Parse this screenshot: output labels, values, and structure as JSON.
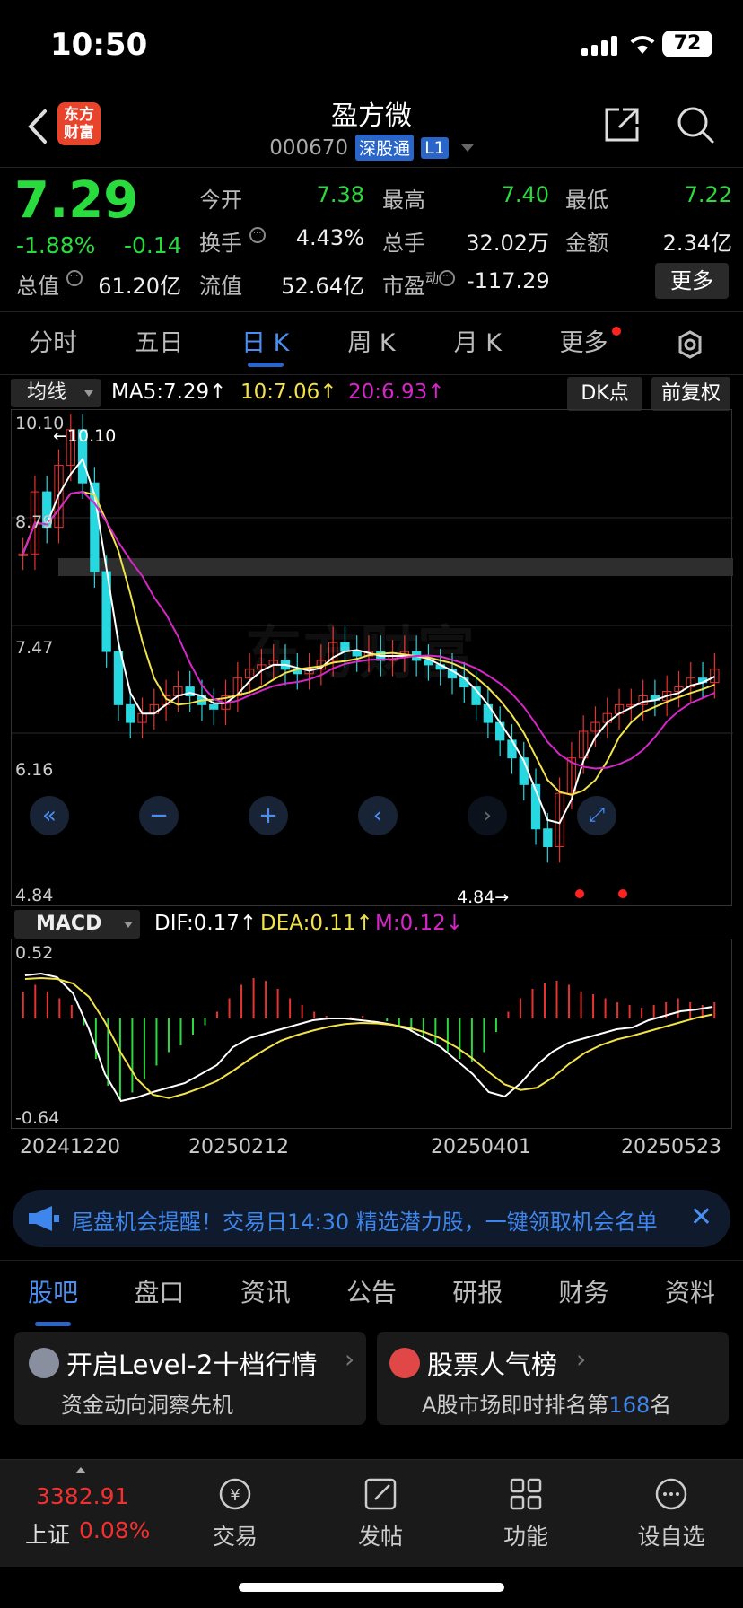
{
  "status": {
    "time": "10:50",
    "battery": "72"
  },
  "header": {
    "logo_line1": "东方",
    "logo_line2": "财富",
    "stock_name": "盈方微",
    "stock_code": "000670",
    "tag_connect": "深股通",
    "tag_level": "L1"
  },
  "quote": {
    "price": "7.29",
    "change_pct": "-1.88%",
    "change_abs": "-0.14",
    "open_label": "今开",
    "open": "7.38",
    "high_label": "最高",
    "high": "7.40",
    "low_label": "最低",
    "low": "7.22",
    "turnover_label": "换手",
    "turnover": "4.43%",
    "volume_label": "总手",
    "volume": "32.02万",
    "amount_label": "金额",
    "amount": "2.34亿",
    "mktcap_label": "总值",
    "mktcap": "61.20亿",
    "float_label": "流值",
    "float": "52.64亿",
    "pe_label": "市盈",
    "pe_sup": "动",
    "pe": "-117.29",
    "more_label": "更多"
  },
  "period_tabs": [
    "分时",
    "五日",
    "日 K",
    "周 K",
    "月 K",
    "更多"
  ],
  "active_period": 2,
  "ma": {
    "selector": "均线",
    "ma5": "MA5:7.29",
    "ma10": "10:7.06",
    "ma20": "20:6.93",
    "dk_label": "DK点",
    "adjust_label": "前复权"
  },
  "colors": {
    "up": "#e8322f",
    "down": "#28d8e0",
    "ma5": "#ffffff",
    "ma10": "#f2e24a",
    "ma20": "#d626c8",
    "accent": "#2a66c9"
  },
  "kline": {
    "axis_labels": [
      "10.10",
      "8.79",
      "7.47",
      "6.16",
      "4.84"
    ],
    "max_marker": "←10.10",
    "min_marker": "4.84→",
    "watermark": "东方财富",
    "ymin": 4.84,
    "ymax": 10.1
  },
  "macd": {
    "selector": "MACD",
    "dif": "DIF:0.17",
    "dea": "DEA:0.11",
    "m": "M:0.12",
    "axis_top": "0.52",
    "axis_bottom": "-0.64"
  },
  "dates": [
    "20241220",
    "20250212",
    "20250401",
    "20250523"
  ],
  "notice": {
    "text": "尾盘机会提醒！交易日14:30 精选潜力股，一键领取机会名单"
  },
  "sub_tabs": [
    "股吧",
    "盘口",
    "资讯",
    "公告",
    "研报",
    "财务",
    "资料"
  ],
  "active_sub_tab": 0,
  "cards": [
    {
      "title": "开启Level-2十档行情",
      "subtitle": "资金动向洞察先机"
    },
    {
      "title": "股票人气榜",
      "subtitle_pre": "A股市场即时排名第",
      "rank": "168",
      "subtitle_post": "名"
    }
  ],
  "bottom_nav": {
    "index_value": "3382.91",
    "index_name": "上证",
    "index_pct": "0.08%",
    "items": [
      "交易",
      "发帖",
      "功能",
      "设自选"
    ]
  }
}
